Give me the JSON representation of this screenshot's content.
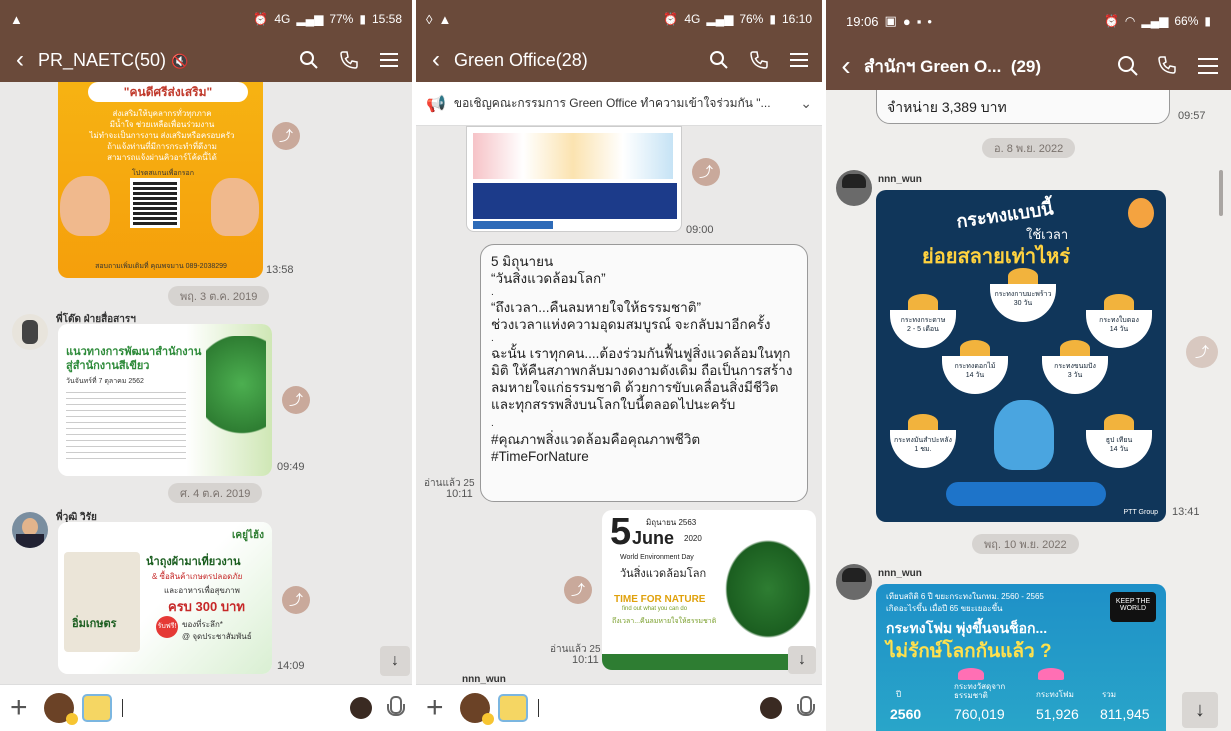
{
  "panel1": {
    "status": {
      "time": "15:58",
      "battery": "77%",
      "net": "4G"
    },
    "title": "PR_NAETC(50)",
    "poster1": {
      "heading": "\"คนดีศรีส่งเสริม\"",
      "lines": [
        "ส่งเสริมให้บุคลากรทั่วทุกภาค",
        "มีน้ำใจ ช่วยเหลือเพื่อนร่วมงาน",
        "ไม่ทำจะเป็นการงาน ส่งเสริมหรือครอบครัว",
        "ถ้าแจ้งท่านที่มีการกระทำที่ดีงาม",
        "สามารถแจ้งผ่านคิวอาร์โค้ดนี้ได้"
      ],
      "scan": "โปรดสแกนเพื่อกรอก",
      "contact": "สอบถามเพิ่มเติมที่ คุณพจมาน 089-2038299",
      "time": "13:58"
    },
    "date1": "พฤ. 3 ต.ค. 2019",
    "sender1": "พี่โต๊ด ฝ่ายสื่อสารฯ",
    "poster2": {
      "heading1": "แนวทางการพัฒนาสำนักงาน",
      "heading2": "สู่สำนักงานสีเขียว",
      "sub": "วันจันทร์ที่ 7 ตุลาคม 2562",
      "time": "09:49"
    },
    "date2": "ศ. 4 ต.ค. 2019",
    "sender2": "พี่วุฒิ วิรัย",
    "poster3": {
      "tag": "เคยู่ไฮ้ง",
      "l1": "นำถุงผ้ามาเที่ยวงาน",
      "l2": "& ซื้อสินค้าเกษตรปลอดภัย",
      "l3": "และอาหารเพื่อสุขภาพ",
      "l4": "ครบ 300 บาท",
      "l5": "รับฟรี!",
      "l6": "ของที่ระลึก*",
      "l7": "@ จุดประชาสัมพันธ์",
      "bag": "อิ่มเกษตร",
      "time": "14:09"
    }
  },
  "panel2": {
    "status": {
      "time": "16:10",
      "battery": "76%",
      "net": "4G"
    },
    "title": "Green Office(28)",
    "announcement": "ขอเชิญคณะกรรมการ Green Office ทำความเข้าใจร่วมกัน \"...",
    "img1_time": "09:00",
    "message": [
      "5 มิถุนายน",
      "“วันสิ่งแวดล้อมโลก”",
      ".",
      "“ถึงเวลา...คืนลมหายใจให้ธรรมชาติ”",
      "ช่วงเวลาแห่งความอุดมสมบูรณ์ จะกลับมาอีกครั้ง",
      ".",
      "ฉะนั้น เราทุกคน....ต้องร่วมกันฟื้นฟูสิ่งแวดล้อมในทุก",
      "มิติ ให้คืนสภาพกลับมางดงามดังเดิม ถือเป็นการสร้าง",
      "ลมหายใจแก่ธรรมชาติ ด้วยการขับเคลื่อนสิ่งมีชีวิต",
      "และทุกสรรพสิ่งบนโลกใบนี้ตลอดไปนะครับ",
      ".",
      "#คุณภาพสิ่งแวดล้อมคือคุณภาพชีวิต",
      "#TimeForNature"
    ],
    "msg_read": "อ่านแล้ว 25",
    "msg_time": "10:11",
    "poster": {
      "day": "5",
      "month": "June",
      "year": "2020",
      "thaidate": "มิถุนายน 2563",
      "en": "World Environment Day",
      "th": "วันสิ่งแวดล้อมโลก",
      "tfn": "TIME FOR NATURE",
      "tfn_sub": "find out what you can do",
      "th2": "ถึงเวลา...คืนลมหายใจให้ธรรมชาติ"
    },
    "poster_read": "อ่านแล้ว 25",
    "poster_time": "10:11",
    "sender_peek": "nnn_wun"
  },
  "panel3": {
    "status": {
      "time": "19:06",
      "battery": "66%"
    },
    "title": "สำนักฯ Green O...",
    "count": "(29)",
    "prev_text": "จำหน่าย 3,389 บาท",
    "prev_time": "09:57",
    "date1": "อ. 8 พ.ย. 2022",
    "sender1": "nnn_wun",
    "infographic": {
      "h1": "กระทงแบบนี้",
      "h2": "ใช้เวลา",
      "h3": "ย่อยสลายเท่าไหร่",
      "items": [
        {
          "name": "กระทงกระดาษ",
          "time": "2 - 5 เดือน"
        },
        {
          "name": "กระทงกาบมะพร้าว",
          "time": "30 วัน"
        },
        {
          "name": "กระทงใบตอง",
          "time": "14 วัน"
        },
        {
          "name": "กระทงดอกไม้",
          "time": "14 วัน"
        },
        {
          "name": "กระทงขนมปัง",
          "time": "3 วัน"
        },
        {
          "name": "กระทงมันสำปะหลัง",
          "time": "1 ชม."
        },
        {
          "name": "ธูป เทียน",
          "time": "14 วัน"
        }
      ],
      "footer": "PTT Group",
      "time": "13:41"
    },
    "date2": "พฤ. 10 พ.ย. 2022",
    "sender2": "nnn_wun",
    "stats": {
      "line1": "เทียบสถิติ 6 ปี ขยะกระทงในกทม. 2560 - 2565",
      "line2": "เกิดอะไรขึ้น เมื่อปี 65 ขยะเยอะขึ้น",
      "title1": "กระทงโฟม พุ่งขึ้นจนช็อก...",
      "title2": "ไม่รักษ์โลกกันแล้ว ?",
      "badge": "KEEP THE WORLD",
      "col_year": "ปี",
      "col_nat": "กระทงวัสดุจาก ธรรมชาติ",
      "col_foam": "กระทงโฟม",
      "col_total": "รวม",
      "year": "2560",
      "nat": "760,019",
      "foam": "51,926",
      "total": "811,945"
    }
  },
  "colors": {
    "header": "#6a4a3a",
    "bubble_border": "#999999",
    "share": "#c9a99b"
  }
}
